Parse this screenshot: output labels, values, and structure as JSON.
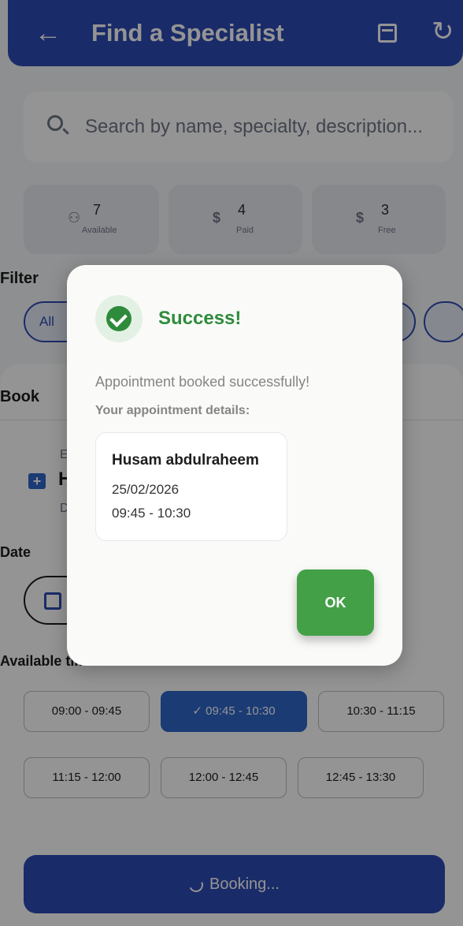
{
  "appbar": {
    "back_icon": "arrow-left-icon",
    "title": "Find a Specialist",
    "calendar_icon": "calendar-icon",
    "refresh_icon": "refresh-icon"
  },
  "search": {
    "placeholder": "Search by name, specialty, description...",
    "icon": "search-icon"
  },
  "stats": [
    {
      "icon": "people-icon",
      "value": "7",
      "label": "Available"
    },
    {
      "icon": "dollar-icon",
      "value": "4",
      "label": "Paid"
    },
    {
      "icon": "dollar-icon",
      "value": "3",
      "label": "Free"
    }
  ],
  "filters": {
    "title": "Filter",
    "first_chip": "All"
  },
  "booking": {
    "title": "Book",
    "line1": "E",
    "name_initial": "H",
    "line3": "D",
    "date_label": "Date",
    "available_times_label": "Available times",
    "slots": [
      {
        "label": "09:00 - 09:45",
        "selected": false
      },
      {
        "label": "09:45 - 10:30",
        "selected": true
      },
      {
        "label": "10:30 - 11:15",
        "selected": false
      },
      {
        "label": "11:15 - 12:00",
        "selected": false
      },
      {
        "label": "12:00 - 12:45",
        "selected": false
      },
      {
        "label": "12:45 - 13:30",
        "selected": false
      }
    ],
    "button_label": "Booking..."
  },
  "dialog": {
    "icon": "check-circle-icon",
    "title": "Success!",
    "message": "Appointment booked successfully!",
    "details_label": "Your appointment details:",
    "details": {
      "name": "Husam abdulraheem",
      "date": "25/02/2026",
      "time": "09:45 - 10:30"
    },
    "ok_label": "OK"
  },
  "colors": {
    "primary": "#2e4bb5",
    "success": "#2e8b3c",
    "ok_button": "#43a047",
    "selected_slot": "#2e66c8"
  }
}
